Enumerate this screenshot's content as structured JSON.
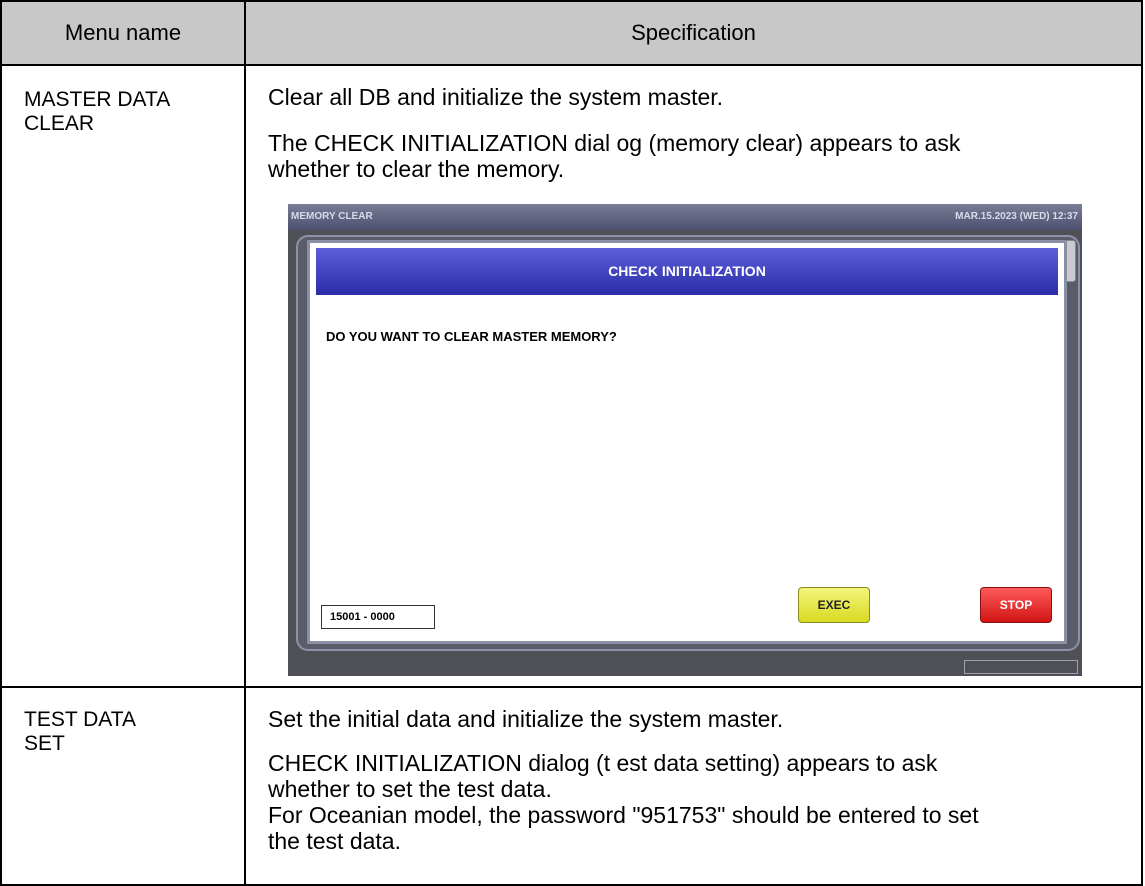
{
  "table": {
    "headers": {
      "menu_name": "Menu name",
      "specification": "Specification"
    },
    "rows": [
      {
        "menu_name_line1": "MASTER DATA",
        "menu_name_line2": "CLEAR",
        "spec_p1": "Clear all DB and initialize the system master.",
        "spec_p2_line1": "The CHECK INITIALIZATION dial og (memory clear) appears to ask",
        "spec_p2_line2": "whether to clear the memory."
      },
      {
        "menu_name_line1": "TEST DATA",
        "menu_name_line2": "SET",
        "spec_p1": "Set the initial data and initialize the system master.",
        "spec_p2_line1": "CHECK INITIALIZATION dialog (t est data setting) appears to ask",
        "spec_p2_line2": "whether to set the test data.",
        "spec_p3_line1": "For Oceanian model, the password \"951753\" should be entered to set",
        "spec_p3_line2": "the test data."
      }
    ]
  },
  "device_screen": {
    "title": "MEMORY CLEAR",
    "datetime": "MAR.15.2023 (WED)  12:37",
    "dialog_title": "CHECK INITIALIZATION",
    "message": "DO YOU WANT TO CLEAR MASTER MEMORY?",
    "code": "15001 - 0000",
    "exec_label": "EXEC",
    "stop_label": "STOP"
  },
  "colors": {
    "header_bg": "#c8c8c8",
    "dialog_title_bg": "#3a3cc0",
    "exec_button": "#e8e84a",
    "stop_button": "#e52222"
  }
}
